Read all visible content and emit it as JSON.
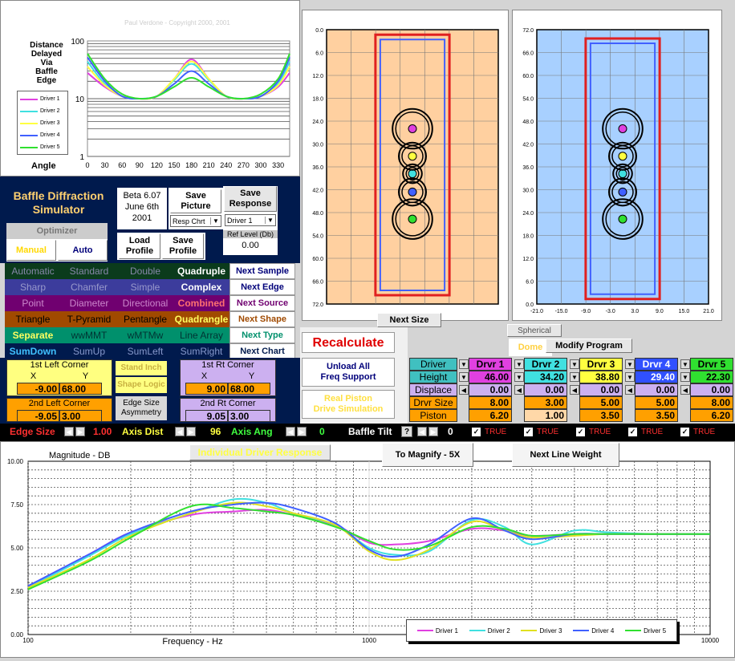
{
  "top_chart": {
    "copyright": "Paul Verdone  -  Copyright  2000, 2001",
    "ylabel_lines": [
      "Distance",
      "Delayed",
      "Via",
      "Baffle",
      "Edge"
    ],
    "xlabel": "Angle",
    "y_ticks": [
      "100",
      "10",
      "1"
    ],
    "x_ticks": [
      "0",
      "30",
      "60",
      "90",
      "120",
      "150",
      "180",
      "210",
      "240",
      "270",
      "300",
      "330"
    ],
    "legend": [
      "Driver 1",
      "Driver 2",
      "Driver 3",
      "Driver 4",
      "Driver 5"
    ]
  },
  "colors": {
    "driver1": "#e040e0",
    "driver2": "#40e0e0",
    "driver3": "#ffff40",
    "driver4": "#4060ff",
    "driver5": "#30e030",
    "red": "#e02020",
    "navy": "#001a4d"
  },
  "app": {
    "title_line1": "Baffle Diffraction",
    "title_line2": "Simulator",
    "version_line1": "Beta 6.07",
    "version_line2": "June 6th",
    "version_line3": "2001",
    "save_picture": "Save Picture",
    "save_response": "Save Response",
    "resp_select": "Resp Chrt",
    "driver_select": "Driver 1",
    "ref_level_label": "Ref Level (Db)",
    "ref_level_value": "0.00",
    "optimizer": "Optimizer",
    "manual": "Manual",
    "auto": "Auto",
    "load_profile": "Load Profile",
    "save_profile": "Save Profile"
  },
  "option_rows": [
    {
      "items": [
        "Automatic",
        "Standard",
        "Double",
        "Quadruple"
      ],
      "next": "Next Sample"
    },
    {
      "items": [
        "Sharp",
        "Chamfer",
        "Simple",
        "Complex"
      ],
      "next": "Next Edge"
    },
    {
      "items": [
        "Point",
        "Diameter",
        "Directional",
        "Combined"
      ],
      "next": "Next Source"
    },
    {
      "items": [
        "Triangle",
        "T-Pyramid",
        "Pentangle",
        "Quadrangle"
      ],
      "next": "Next Shape"
    },
    {
      "items": [
        "Separate",
        "wwMMT",
        "wMTMw",
        "Line Array"
      ],
      "next": "Next Type"
    },
    {
      "items": [
        "SumDown",
        "SumUp",
        "SumLeft",
        "SumRight"
      ],
      "next": "Next Chart"
    }
  ],
  "corners": {
    "left_title": "1st Left Corner",
    "right_title": "1st Rt Corner",
    "x": "X",
    "y": "Y",
    "left_x": "-9.00",
    "left_y": "68.00",
    "right_x": "9.00",
    "right_y": "68.00",
    "stand_inch": "Stand Inch",
    "shape_logic": "Shape Logic",
    "edge_size": "Edge Size",
    "asymmetry": "Asymmetry",
    "left2_title": "2nd Left Corner",
    "right2_title": "2nd Rt Corner",
    "left2_x": "-9.05",
    "left2_y": "3.00",
    "right2_x": "9.05",
    "right2_y": "3.00"
  },
  "recalc": {
    "recalculate": "Recalculate",
    "unload_line1": "Unload All",
    "unload_line2": "Freq Support",
    "piston_line1": "Real Piston",
    "piston_line2": "Drive Simulation"
  },
  "baffle_left": {
    "y_ticks": [
      "0.0",
      "6.0",
      "12.0",
      "18.0",
      "24.0",
      "30.0",
      "36.0",
      "42.0",
      "48.0",
      "54.0",
      "60.0",
      "66.0",
      "72.0"
    ]
  },
  "baffle_right": {
    "y_ticks": [
      "72.0",
      "66.0",
      "60.0",
      "54.0",
      "48.0",
      "42.0",
      "36.0",
      "30.0",
      "24.0",
      "18.0",
      "12.0",
      "6.0",
      "0.0"
    ],
    "x_ticks": [
      "-21.0",
      "-15.0",
      "-9.0",
      "-3.0",
      "3.0",
      "9.0",
      "15.0",
      "21.0"
    ]
  },
  "mid_buttons": {
    "next_size": "Next Size",
    "spherical": "Spherical",
    "dome": "Dome",
    "modify_program": "Modify Program"
  },
  "driver_table": {
    "row_labels": [
      "Driver",
      "Height",
      "Displace",
      "Drvr Size",
      "Piston"
    ],
    "headers": [
      "Drvr 1",
      "Drvr 2",
      "Drvr 3",
      "Drvr 4",
      "Drvr 5"
    ],
    "height": [
      "46.00",
      "34.20",
      "38.80",
      "29.40",
      "22.30"
    ],
    "displace": [
      "0.00",
      "0.00",
      "0.00",
      "0.00",
      "0.00"
    ],
    "size": [
      "8.00",
      "3.00",
      "5.00",
      "5.00",
      "8.00"
    ],
    "piston": [
      "6.20",
      "1.00",
      "3.50",
      "3.50",
      "6.20"
    ]
  },
  "status_bar": {
    "edge_size_label": "Edge Size",
    "edge_size_value": "1.00",
    "axis_dist_label": "Axis Dist",
    "axis_dist_value": "96",
    "axis_ang_label": "Axis Ang",
    "axis_ang_value": "0",
    "baffle_tilt_label": "Baffle Tilt",
    "question": "?",
    "baffle_tilt_value": "0",
    "flags": [
      "TRUE",
      "TRUE",
      "TRUE",
      "TRUE",
      "TRUE"
    ]
  },
  "bottom_chart": {
    "individual": "Individual Driver Response",
    "magnify": "To Magnify - 5X",
    "line_weight": "Next Line Weight",
    "title": "Magnitude  -  DB",
    "xlabel": "Frequency  -  Hz",
    "y_ticks": [
      "10.00",
      "7.50",
      "5.00",
      "2.50",
      "0.00"
    ],
    "x_ticks": [
      "100",
      "1000",
      "10000"
    ],
    "legend": [
      "Driver 1",
      "Driver 2",
      "Driver 3",
      "Driver 4",
      "Driver 5"
    ]
  },
  "chart_data": [
    {
      "type": "line",
      "xlabel": "Angle",
      "x": [
        0,
        30,
        60,
        90,
        120,
        150,
        180,
        210,
        240,
        270,
        300,
        330,
        350
      ],
      "ylim": [
        1,
        100
      ],
      "log_y": true,
      "series": [
        {
          "name": "Driver 1",
          "values": [
            28,
            16,
            11,
            10,
            11,
            22,
            48,
            22,
            11,
            10,
            11,
            16,
            28
          ]
        },
        {
          "name": "Driver 2",
          "values": [
            44,
            18,
            11,
            10,
            11,
            21,
            40,
            21,
            11,
            10,
            11,
            18,
            44
          ]
        },
        {
          "name": "Driver 3",
          "values": [
            36,
            17,
            11,
            10,
            11,
            22,
            44,
            22,
            11,
            10,
            11,
            17,
            36
          ]
        },
        {
          "name": "Driver 4",
          "values": [
            52,
            20,
            11,
            10,
            11,
            18,
            30,
            18,
            11,
            10,
            11,
            20,
            52
          ]
        },
        {
          "name": "Driver 5",
          "values": [
            60,
            22,
            12,
            10,
            11,
            16,
            23,
            16,
            11,
            10,
            12,
            22,
            60
          ]
        }
      ]
    },
    {
      "type": "line",
      "title": "Magnitude  -  DB",
      "xlabel": "Frequency  -  Hz",
      "x": [
        100,
        150,
        200,
        300,
        400,
        500,
        600,
        800,
        1000,
        1200,
        1500,
        2000,
        2500,
        3000,
        4000,
        5000,
        7000,
        10000
      ],
      "ylim": [
        0,
        10
      ],
      "log_x": true,
      "series": [
        {
          "name": "Driver 1",
          "values": [
            2.8,
            4.6,
            5.9,
            6.9,
            7.1,
            7.2,
            6.9,
            6.3,
            5.3,
            5.2,
            5.4,
            6.1,
            6.0,
            5.7,
            5.8,
            5.8,
            5.8,
            5.8
          ]
        },
        {
          "name": "Driver 2",
          "values": [
            2.7,
            4.5,
            5.8,
            7.0,
            7.8,
            7.6,
            7.0,
            6.3,
            5.0,
            4.6,
            4.8,
            6.6,
            6.2,
            5.2,
            6.0,
            5.9,
            5.8,
            5.8
          ]
        },
        {
          "name": "Driver 3",
          "values": [
            2.7,
            4.3,
            5.7,
            7.0,
            7.6,
            7.4,
            7.0,
            6.3,
            4.8,
            4.3,
            4.9,
            6.5,
            6.0,
            5.6,
            5.7,
            5.8,
            5.8,
            5.8
          ]
        },
        {
          "name": "Driver 4",
          "values": [
            2.8,
            4.6,
            5.9,
            7.1,
            7.5,
            7.6,
            7.3,
            6.4,
            4.9,
            4.5,
            5.2,
            6.7,
            6.0,
            5.5,
            5.8,
            5.8,
            5.8,
            5.8
          ]
        },
        {
          "name": "Driver 5",
          "values": [
            2.6,
            4.2,
            5.6,
            7.4,
            7.3,
            7.1,
            6.9,
            6.2,
            5.4,
            4.9,
            5.1,
            6.2,
            6.1,
            5.7,
            5.8,
            5.8,
            5.8,
            5.8
          ]
        }
      ]
    }
  ]
}
